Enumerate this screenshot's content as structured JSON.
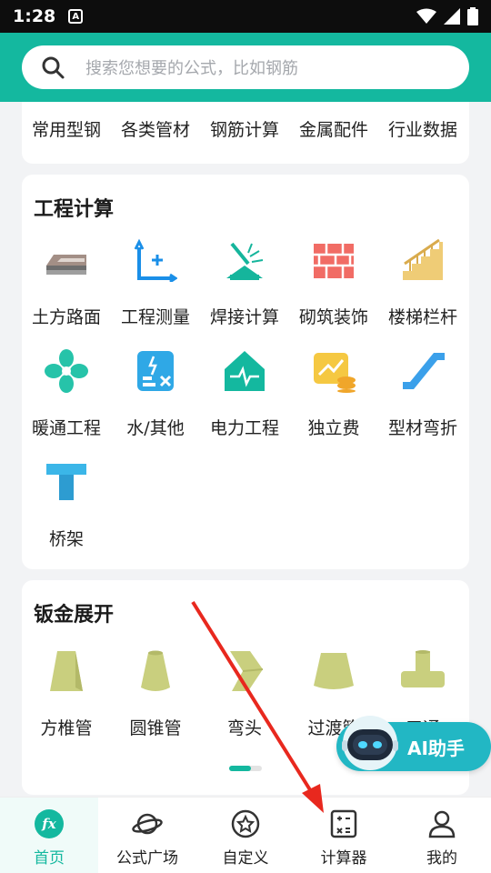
{
  "status": {
    "time": "1:28",
    "a_icon": "A"
  },
  "search": {
    "placeholder": "搜索您想要的公式，比如钢筋"
  },
  "top_items": [
    "常用型钢",
    "各类管材",
    "钢筋计算",
    "金属配件",
    "行业数据"
  ],
  "engineering": {
    "title": "工程计算",
    "items": [
      {
        "label": "土方路面",
        "icon": "road-icon"
      },
      {
        "label": "工程测量",
        "icon": "axis-measure-icon"
      },
      {
        "label": "焊接计算",
        "icon": "welding-icon"
      },
      {
        "label": "砌筑装饰",
        "icon": "brick-wall-icon"
      },
      {
        "label": "楼梯栏杆",
        "icon": "stairs-railing-icon"
      },
      {
        "label": "暖通工程",
        "icon": "fan-icon"
      },
      {
        "label": "水/其他",
        "icon": "water-icon"
      },
      {
        "label": "电力工程",
        "icon": "power-house-icon"
      },
      {
        "label": "独立费",
        "icon": "fee-icon"
      },
      {
        "label": "型材弯折",
        "icon": "profile-bend-icon"
      },
      {
        "label": "桥架",
        "icon": "cable-tray-icon"
      }
    ]
  },
  "sheetmetal": {
    "title": "钣金展开",
    "items": [
      {
        "label": "方椎管",
        "icon": "square-cone-icon"
      },
      {
        "label": "圆锥管",
        "icon": "round-cone-icon"
      },
      {
        "label": "弯头",
        "icon": "elbow-icon"
      },
      {
        "label": "过渡管",
        "icon": "transition-pipe-icon"
      },
      {
        "label": "三通",
        "icon": "tee-pipe-icon"
      }
    ]
  },
  "ai": {
    "label": "AI助手"
  },
  "tabs": [
    {
      "label": "首页",
      "icon": "fx-icon",
      "active": true
    },
    {
      "label": "公式广场",
      "icon": "planet-icon",
      "active": false
    },
    {
      "label": "自定义",
      "icon": "star-circle-icon",
      "active": false
    },
    {
      "label": "计算器",
      "icon": "calculator-icon",
      "active": false
    },
    {
      "label": "我的",
      "icon": "person-icon",
      "active": false
    }
  ],
  "colors": {
    "accent": "#14b89f",
    "annotation_arrow": "#e8281e",
    "ai_button": "#22b7c4"
  }
}
